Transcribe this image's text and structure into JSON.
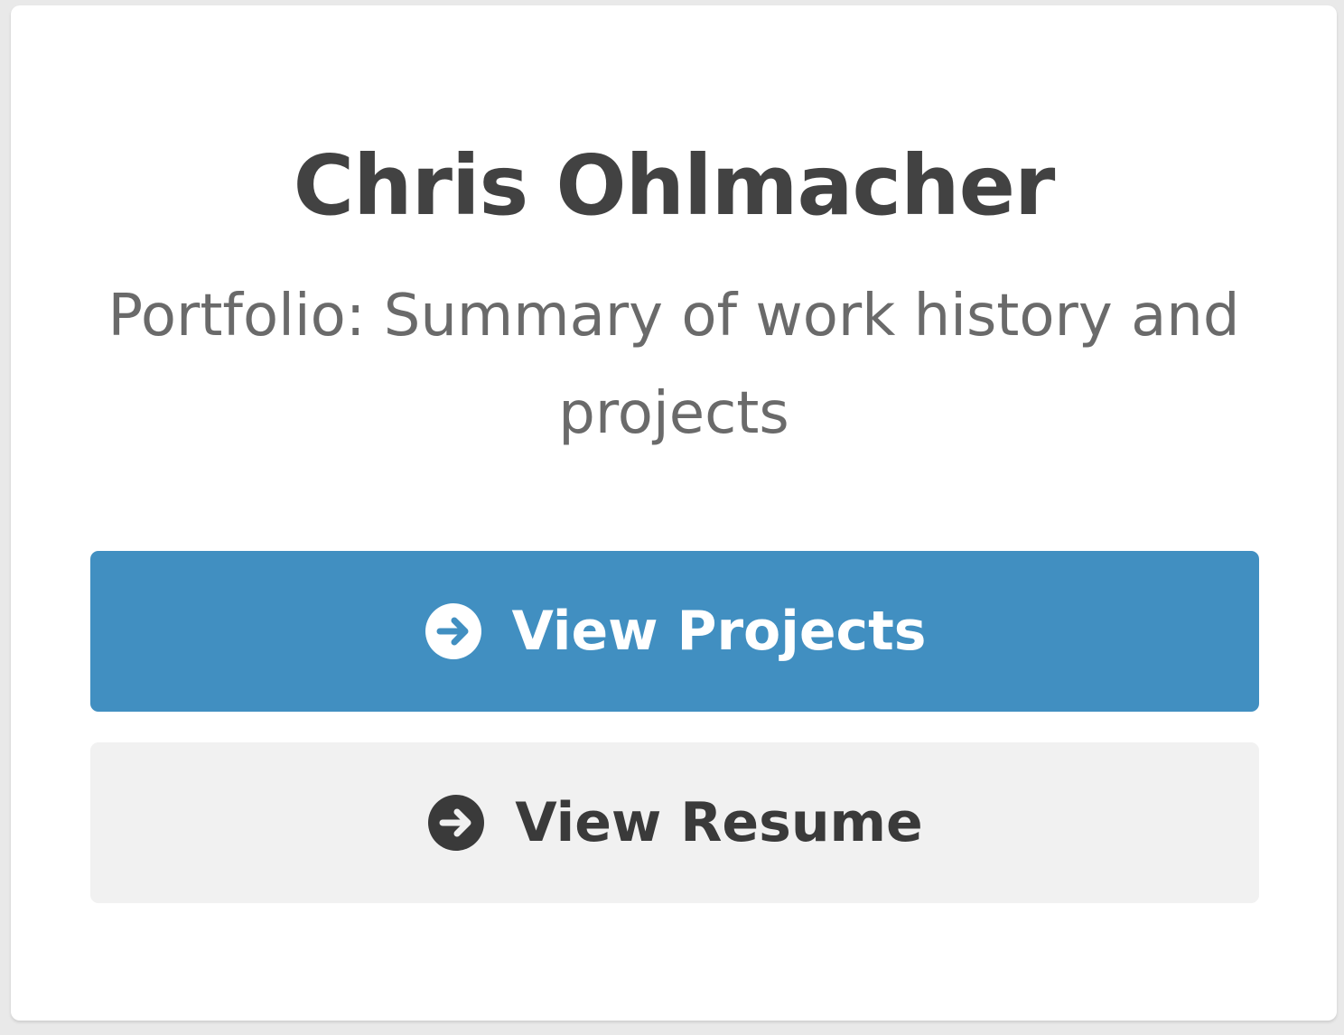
{
  "profile": {
    "name": "Chris Ohlmacher",
    "subtitle": "Portfolio: Summary of work history and projects"
  },
  "buttons": {
    "projects": {
      "label": "View Projects",
      "icon": "arrow-circle-right-icon"
    },
    "resume": {
      "label": "View Resume",
      "icon": "arrow-circle-right-icon"
    }
  },
  "colors": {
    "primary": "#418fc1",
    "secondary": "#f1f1f1",
    "text_dark": "#424242",
    "text_muted": "#6a6a6a"
  }
}
